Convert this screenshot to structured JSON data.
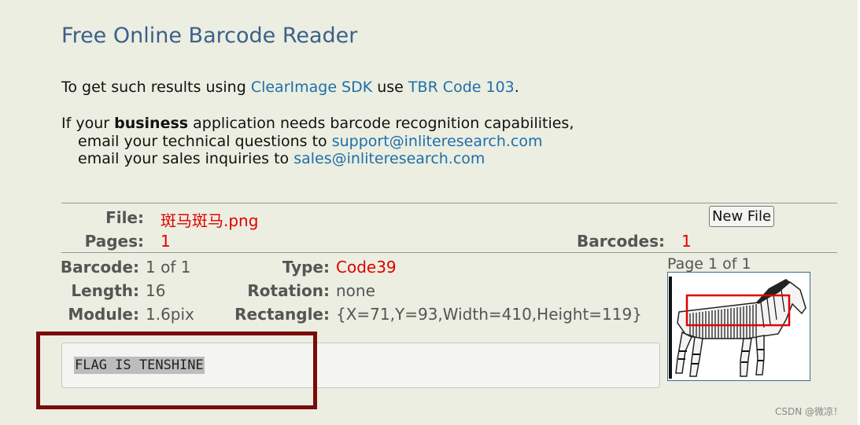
{
  "title": "Free Online Barcode Reader",
  "intro": {
    "prefix": "To get such results using ",
    "sdk_link": "ClearImage SDK",
    "middle": " use ",
    "code_link": "TBR Code 103",
    "suffix": "."
  },
  "business": {
    "prefix": "If your ",
    "bold": "business",
    "suffix": " application needs barcode recognition capabilities,",
    "tech_prefix": "email your technical questions to ",
    "tech_email": "support@inliteresearch.com",
    "sales_prefix": "email your sales inquiries to ",
    "sales_email": "sales@inliteresearch.com"
  },
  "file": {
    "file_label": "File:",
    "file_name": "斑马斑马.png",
    "pages_label": "Pages:",
    "pages_value": "1",
    "barcodes_label": "Barcodes:",
    "barcodes_value": "1",
    "new_file_button": "New File"
  },
  "barcode": {
    "barcode_label": "Barcode:",
    "barcode_value": "1 of 1",
    "length_label": "Length:",
    "length_value": "16",
    "module_label": "Module:",
    "module_value": "1.6pix",
    "type_label": "Type:",
    "type_value": "Code39",
    "rotation_label": "Rotation:",
    "rotation_value": "none",
    "rectangle_label": "Rectangle:",
    "rectangle_value": "{X=71,Y=93,Width=410,Height=119}"
  },
  "preview": {
    "page_label": "Page 1 of 1"
  },
  "result": {
    "text": "FLAG IS TENSHINE"
  },
  "watermark": "CSDN @微凉！",
  "colors": {
    "background": "#ebeee0",
    "title": "#3c5f8c",
    "link": "#1f6eaa",
    "value_red": "#e00000",
    "highlight_border": "#7a0b0b"
  }
}
